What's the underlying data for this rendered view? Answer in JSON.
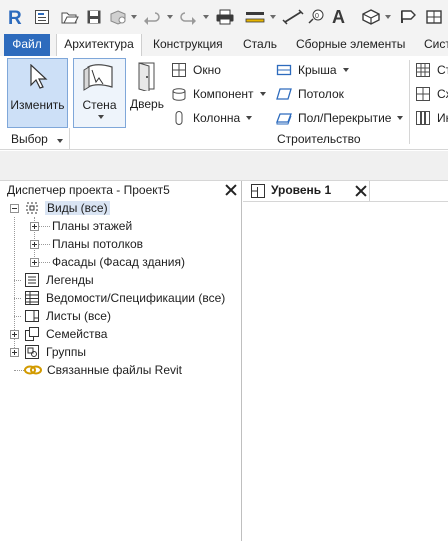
{
  "qat": {
    "icons": [
      "revit-logo",
      "info-center",
      "open-file",
      "save",
      "sync",
      "undo",
      "redo",
      "print",
      "measure",
      "dimension",
      "tag",
      "text",
      "3d-view",
      "section",
      "thin-lines"
    ]
  },
  "tabs": [
    {
      "label": "Файл",
      "active": false,
      "file": true
    },
    {
      "label": "Архитектура",
      "active": true
    },
    {
      "label": "Конструкция"
    },
    {
      "label": "Сталь"
    },
    {
      "label": "Сборные элементы"
    },
    {
      "label": "Сист"
    }
  ],
  "ribbon": {
    "modify_label": "Изменить",
    "wall_label": "Стена",
    "door_label": "Дверь",
    "window_label": "Окно",
    "component_label": "Компонент",
    "column_label": "Колонна",
    "roof_label": "Крыша",
    "ceiling_label": "Потолок",
    "floor_label": "Пол/Перекрытие",
    "right_col": [
      "Ст",
      "Сх",
      "Ин"
    ],
    "select_panel": "Выбор",
    "build_panel": "Строительство"
  },
  "browser": {
    "title": "Диспетчер проекта - Проект5",
    "views_root": "Виды (все)",
    "floor_plans": "Планы этажей",
    "ceiling_plans": "Планы потолков",
    "elevations": "Фасады (Фасад здания)",
    "legends": "Легенды",
    "schedules": "Ведомости/Спецификации (все)",
    "sheets": "Листы (все)",
    "families": "Семейства",
    "groups": "Группы",
    "links": "Связанные файлы Revit"
  },
  "view": {
    "tab_label": "Уровень 1"
  },
  "colors": {
    "file_tab": "#2d6bbd",
    "accent_blue": "#2d6bbd",
    "selected_bg": "#cde0f7",
    "link_icon": "#e0a800"
  }
}
